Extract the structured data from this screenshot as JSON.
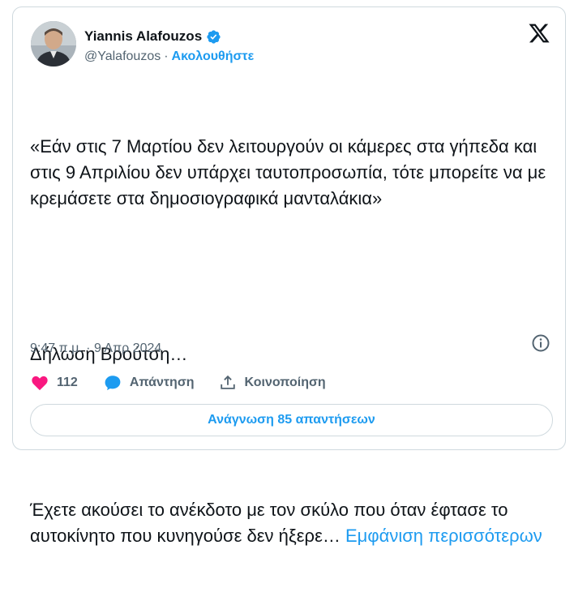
{
  "author": {
    "name": "Yiannis Alafouzos",
    "handle": "@Yalafouzos",
    "separator": "·",
    "follow_label": "Ακολουθήστε"
  },
  "tweet": {
    "paragraph1": "«Εάν στις 7 Μαρτίου δεν λειτουργούν οι κάμερες στα γήπεδα και στις 9 Απριλίου δεν υπάρχει ταυτοπροσωπία, τότε μπορείτε να με κρεμάσετε στα δημοσιογραφικά μανταλάκια»",
    "paragraph2": "Δήλωση Βρούτση…",
    "paragraph3": "Έχετε ακούσει το ανέκδοτο με τον σκύλο που όταν έφτασε το  αυτοκίνητο που κυνηγούσε δεν ήξερε… ",
    "show_more": "Εμφάνιση περισσότερων",
    "timestamp": "9:47 π.μ. · 9 Απρ 2024"
  },
  "actions": {
    "like_count": "112",
    "reply_label": "Απάντηση",
    "share_label": "Κοινοποίηση"
  },
  "read_replies_label": "Ανάγνωση 85 απαντήσεων",
  "colors": {
    "accent": "#1d9bf0",
    "like": "#f91880",
    "secondary_text": "#536471",
    "border": "#cfd9de"
  }
}
